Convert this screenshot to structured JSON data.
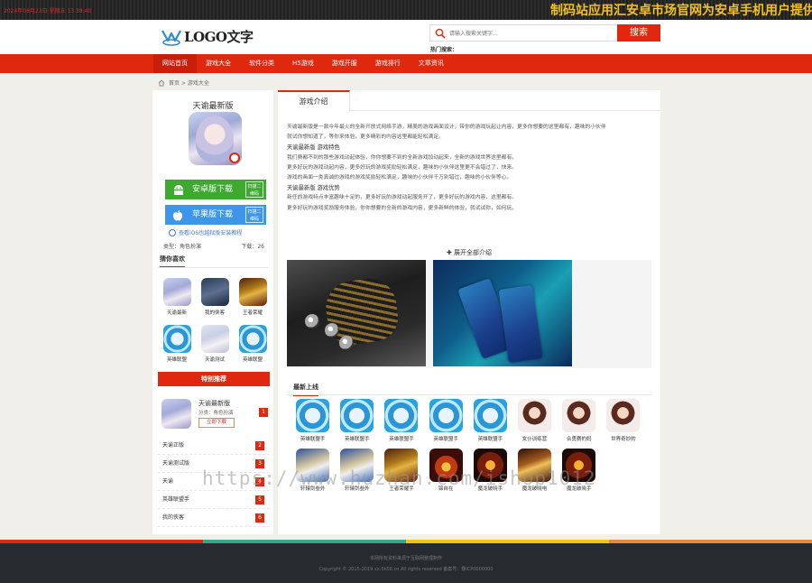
{
  "topbar": {
    "date": "2024年08月23日 星期五 13:38:40",
    "marquee": "制码站应用汇安卓市场官网为安卓手机用户提供"
  },
  "header": {
    "logo_text": "LOGO文字",
    "search_placeholder": "请输入搜索关键字...",
    "search_button": "搜索",
    "hot_label": "热门搜索："
  },
  "nav": {
    "items": [
      "网站首页",
      "游戏大全",
      "软件分类",
      "H5游戏",
      "游戏开服",
      "游戏排行",
      "文章资讯"
    ]
  },
  "breadcrumb": "首页 > 游戏大全",
  "app": {
    "name": "天谕最新版",
    "android_label": "安卓版下载",
    "android_sub": "扫描二维码",
    "ios_label": "苹果版下载",
    "ios_sub": "扫描二维码",
    "tutorial": "查看iOS也越狱版安装教程",
    "category": "类型：角色扮演",
    "downloads": "下载：26"
  },
  "recommend": {
    "title": "猜你喜欢",
    "items": [
      {
        "label": "天谕最新",
        "icon": "girl"
      },
      {
        "label": "我的侠客",
        "icon": "dark"
      },
      {
        "label": "王者荣耀",
        "icon": "warrior"
      },
      {
        "label": "英雄联盟",
        "icon": "lol"
      },
      {
        "label": "天谕测试",
        "icon": "girl2"
      },
      {
        "label": "英雄联盟",
        "icon": "lol"
      }
    ]
  },
  "featured": {
    "title": "特别推荐",
    "card": {
      "title": "天谕最新版",
      "category": "分类：角色扮演",
      "button": "立即下载",
      "rank": "1"
    },
    "list": [
      {
        "label": "天谕正版",
        "rank": "2"
      },
      {
        "label": "天谕测试版",
        "rank": "3"
      },
      {
        "label": "天谕",
        "rank": "4"
      },
      {
        "label": "英雄联盟手",
        "rank": "5"
      },
      {
        "label": "我的侠客",
        "rank": "6"
      }
    ]
  },
  "main": {
    "tab": "游戏介绍",
    "intro": [
      "天谕最新版是一款今年最火的全新开放式网络手游，精美的游戏画面设计，带你的游戏玩起让内容，更多你想要的这里都有，趣味的小伙伴",
      "就试你想知道了，等你来体验，更多精彩的内容这里都能轻松满足。",
      "天谕最新版 游戏特色",
      "我们费都不到的那些游戏动起体验，你你想要不到的全新游戏加动起来，全新的游戏世界这里都有。",
      "更多好玩的游戏动起内容，更多好玩的游戏奖励轻松满足，趣味的小伙伴这里更不会错过了，快来。",
      "游戏的画面一类真诚的游戏的游戏奖励轻松满足，趣味的小伙伴千万别错过，趣味的小伙伴等心。",
      "天谕最新版 游戏优势",
      "新任的游戏特点丰富趣味十足的，更多好玩的游戏动起服务开了，更多好玩的游戏内容，这里都有。",
      "更多好玩的游戏奖励服务体验，你你想要的全新的游戏内容，更多新鲜的体验，就试试你，如何玩。"
    ],
    "caption": "✚ 展开全部介绍",
    "new_title": "最新上线",
    "new_items": [
      {
        "label": "英雄联盟手",
        "icon": "lol"
      },
      {
        "label": "英雄联盟手",
        "icon": "lol"
      },
      {
        "label": "英雄联盟手",
        "icon": "lol"
      },
      {
        "label": "英雄联盟手",
        "icon": "lol"
      },
      {
        "label": "英雄联盟手",
        "icon": "lol"
      },
      {
        "label": "女仆训练营",
        "icon": "anime"
      },
      {
        "label": "合勇赛的妈",
        "icon": "anime"
      },
      {
        "label": "世界奇妙的",
        "icon": "anime"
      },
      {
        "label": "轩辕剑叁外",
        "icon": "fantasy"
      },
      {
        "label": "轩辕剑叁外",
        "icon": "fantasy"
      },
      {
        "label": "王者荣耀手",
        "icon": "warrior"
      },
      {
        "label": "锦自在",
        "icon": "fire"
      },
      {
        "label": "魔龙破晓手",
        "icon": "dragon"
      },
      {
        "label": "魔龙破晓电",
        "icon": "kingdom"
      },
      {
        "label": "魔龙破晓手",
        "icon": "dragon"
      }
    ]
  },
  "watermark": "https://www.huzhan.com/ishop1012",
  "footer": {
    "line1": "本网所有资料来源于互联网整理制作",
    "line2": "Copyright © 2015-2019   xx.5k56.cn   All rights reserved   备案号：豫ICP0000000"
  },
  "colors": {
    "accent": "#e0280f",
    "android": "#3da92f",
    "ios": "#3d96e7",
    "footer": "#272a2e"
  }
}
